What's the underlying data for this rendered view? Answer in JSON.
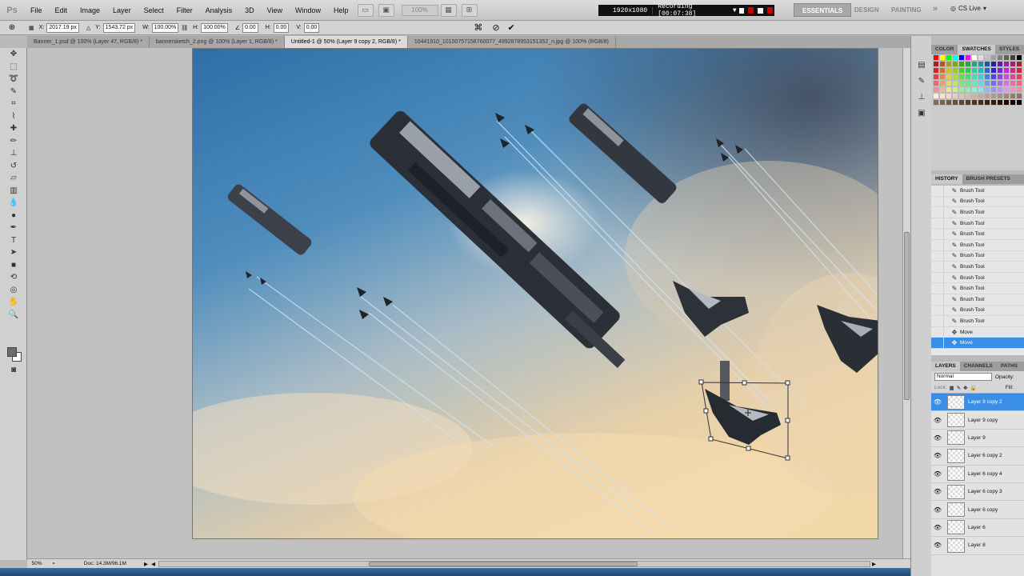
{
  "app": {
    "logo": "Ps"
  },
  "menu": [
    "File",
    "Edit",
    "Image",
    "Layer",
    "Select",
    "Filter",
    "Analysis",
    "3D",
    "View",
    "Window",
    "Help"
  ],
  "zoom_level": "100%",
  "recorder": {
    "resolution": "1920x1080",
    "status": "Recording [00:07:38]"
  },
  "workspaces": {
    "essentials": "ESSENTIALS",
    "design": "DESIGN",
    "painting": "PAINTING",
    "more": "»",
    "cslive": "CS Live"
  },
  "options": {
    "x_label": "X:",
    "x": "2017.19 px",
    "y_label": "Y:",
    "y": "1543.72 px",
    "w_label": "W:",
    "w": "100.00%",
    "h_label": "H:",
    "h": "100.00%",
    "angle": "0.00",
    "hskew_label": "H:",
    "hskew": "0.00",
    "vskew_label": "V:",
    "vskew": "0.00"
  },
  "doc_tabs": [
    "Banner_1.psd @ 100% (Layer 47, RGB/8) *",
    "bannersketch_2.png @ 100% (Layer 1, RGB/8) *",
    "Untitled-1 @ 50% (Layer 9 copy 2, RGB/8) *",
    "10441910_10100757158760077_4992878953151352_n.jpg @ 100% (RGB/8)"
  ],
  "status": {
    "zoom": "50%",
    "doc": "Doc: 14.3M/96.1M"
  },
  "color_panel": {
    "tabs": [
      "COLOR",
      "SWATCHES",
      "STYLES"
    ]
  },
  "history_panel": {
    "tabs": [
      "HISTORY",
      "BRUSH PRESETS"
    ],
    "items": [
      "Brush Tool",
      "Brush Tool",
      "Brush Tool",
      "Brush Tool",
      "Brush Tool",
      "Brush Tool",
      "Brush Tool",
      "Brush Tool",
      "Brush Tool",
      "Brush Tool",
      "Brush Tool",
      "Brush Tool",
      "Brush Tool",
      "Move",
      "Move"
    ]
  },
  "layers_panel": {
    "tabs": [
      "LAYERS",
      "CHANNELS",
      "PATHS"
    ],
    "blend_mode": "Normal",
    "opacity_label": "Opacity:",
    "lock_label": "Lock:",
    "fill_label": "Fill:",
    "layers": [
      "Layer 9 copy 2",
      "Layer 9 copy",
      "Layer 9",
      "Layer 6 copy 2",
      "Layer 6 copy 4",
      "Layer 6 copy 3",
      "Layer 6 copy",
      "Layer 6",
      "Layer 8"
    ]
  }
}
